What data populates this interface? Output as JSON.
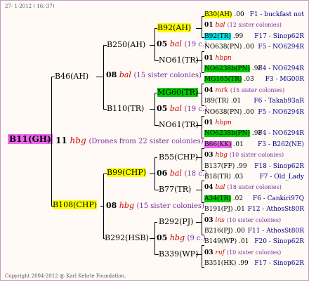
{
  "header": "27-  1-2012 ( 16: 37)",
  "footer": "Copyright 2004-2012 @ Karl Kehrle Foundation.",
  "root": {
    "label": "B11(GH)",
    "year": "11",
    "breeder": "hbg",
    "note": "(Drones from 22 sister colonies)"
  },
  "gen1": [
    {
      "label": "B46(AH)",
      "year": "08",
      "breeder": "bal",
      "note": "(15 sister colonies)"
    },
    {
      "label": "B108(CHP)",
      "year": "08",
      "breeder": "hbg",
      "note": "(15 sister colonies)"
    }
  ],
  "gen2": [
    {
      "label": "B250(AH)",
      "year": "05",
      "breeder": "bal",
      "note": "(19 c.)"
    },
    {
      "label": "B110(TR)",
      "year": "05",
      "breeder": "bal",
      "note": "(19 c.)"
    },
    {
      "label": "B99(CHP)",
      "year": "06",
      "breeder": "bal",
      "note": "(18 c.)"
    },
    {
      "label": "B292(HSB)",
      "year": "05",
      "breeder": "hbg",
      "note": "(9 c.)"
    }
  ],
  "gen3": [
    "B92(AH)",
    "NO61(TR)",
    "MG60(TR)",
    "NO61(TR)",
    "B55(CHP)",
    "B77(TR)",
    "B292(PJ)",
    "B339(WP)"
  ],
  "leaves": [
    {
      "label": "B30(AH)",
      "val": ".00",
      "code": "F1 - buckfast not"
    },
    {
      "year": "01",
      "breeder": "bal",
      "note": "(12 sister colonies)"
    },
    {
      "label": "B92(TR)",
      "val": ".99",
      "code": "F17 - Sinop62R"
    },
    {
      "label": "NO638(PN)",
      "val": ".00",
      "code": "F5 - NO6294R"
    },
    {
      "year": "01",
      "breeder": "hbpn",
      "note": ""
    },
    {
      "label": "NO6238b(PN)",
      "val": ".98",
      "code": "F4 - NO6294R"
    },
    {
      "label": "MG165(TR)",
      "val": ".03",
      "code": "F3 - MG00R"
    },
    {
      "year": "04",
      "breeder": "mrk",
      "note": "(15 sister colonies)"
    },
    {
      "label": "I89(TR)",
      "val": ".01",
      "code": "F6 - Takab93aR"
    },
    {
      "label": "NO638(PN)",
      "val": ".00",
      "code": "F5 - NO6294R"
    },
    {
      "year": "01",
      "breeder": "hbpn",
      "note": ""
    },
    {
      "label": "NO6238b(PN)",
      "val": ".98",
      "code": "F4 - NO6294R"
    },
    {
      "label": "B66(KK)",
      "val": ".01",
      "code": "F3 - B262(NE)"
    },
    {
      "year": "03",
      "breeder": "hbg",
      "note": "(10 sister colonies)"
    },
    {
      "label": "B137(FF)",
      "val": ".99",
      "code": "F18 - Sinop62R"
    },
    {
      "label": "B18(TR)",
      "val": ".03",
      "code": "F7 - Old_Lady"
    },
    {
      "year": "04",
      "breeder": "bal",
      "note": "(18 sister colonies)"
    },
    {
      "label": "A34(TR)",
      "val": ".02",
      "code": "F6 - Cankiri97Q"
    },
    {
      "label": "B191(PJ)",
      "val": ".01",
      "code": "F12 - AthosSt80R"
    },
    {
      "year": "03",
      "breeder": "ins",
      "note": "(10 sister colonies)"
    },
    {
      "label": "B216(PJ)",
      "val": ".00",
      "code": "F11 - AthosSt80R"
    },
    {
      "label": "B149(WP)",
      "val": ".01",
      "code": "F20 - Sinop62R"
    },
    {
      "year": "03",
      "breeder": "ruf",
      "note": "(10 sister colonies)"
    },
    {
      "label": "B351(HK)",
      "val": ".99",
      "code": "F17 - Sinop62R"
    }
  ]
}
